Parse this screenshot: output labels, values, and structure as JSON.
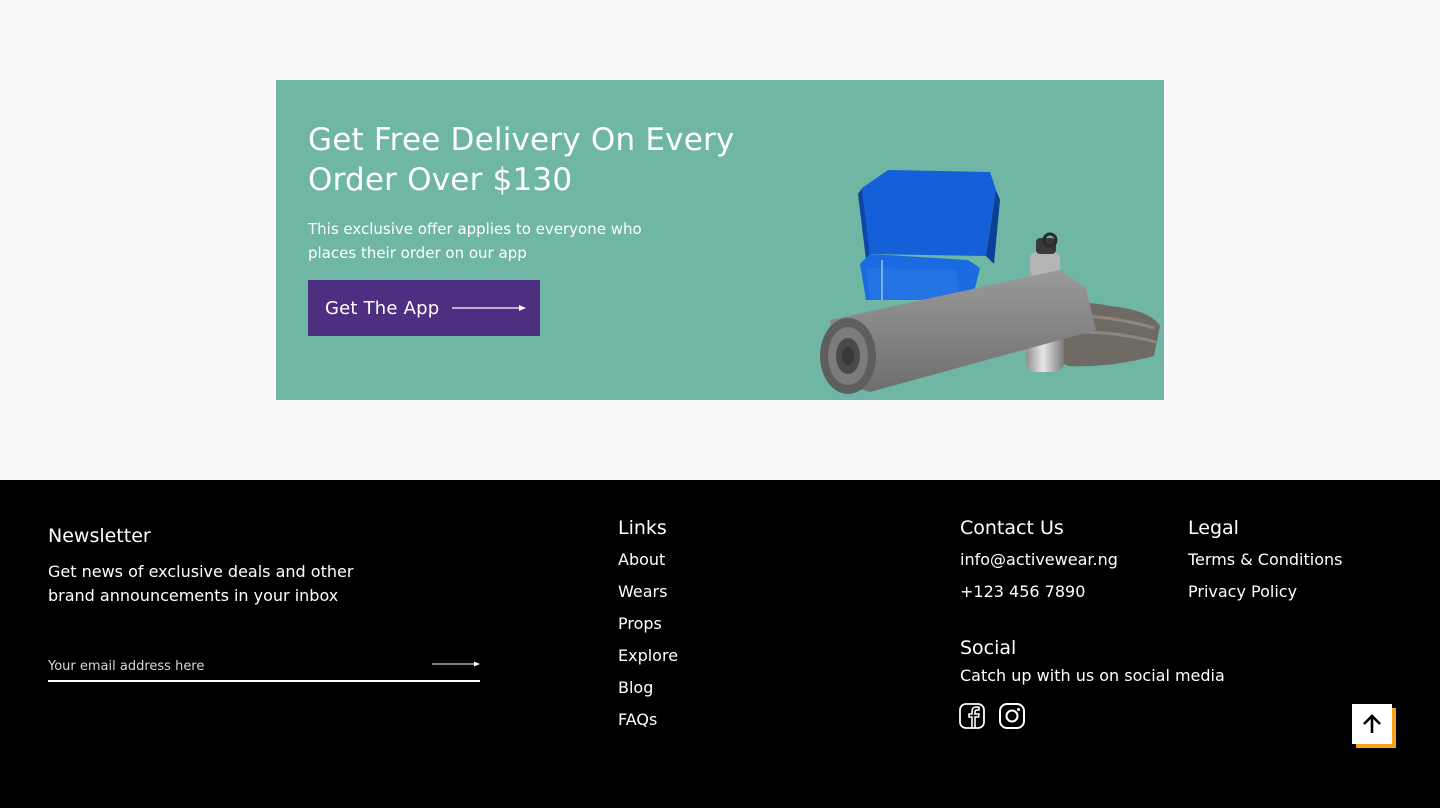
{
  "promo": {
    "title": "Get Free Delivery On Every Order Over $130",
    "subtitle": "This exclusive offer applies to everyone who places their order on our app",
    "cta_label": "Get The App",
    "background_color": "#6fb6a4",
    "cta_color": "#4d2e80",
    "image_icon": "fitness-gear-image"
  },
  "footer": {
    "newsletter": {
      "heading": "Newsletter",
      "description": "Get news of exclusive deals and other brand announcements  in your inbox",
      "email_placeholder": "Your email address here",
      "submit_icon": "arrow-right-icon"
    },
    "links": {
      "heading": "Links",
      "items": [
        "About",
        "Wears",
        "Props",
        "Explore",
        "Blog",
        "FAQs"
      ]
    },
    "contact": {
      "heading": "Contact Us",
      "email": "info@activewear.ng",
      "phone": "+123 456 7890"
    },
    "legal": {
      "heading": "Legal",
      "items": [
        "Terms & Conditions",
        "Privacy Policy"
      ]
    },
    "social": {
      "heading": "Social",
      "description": "Catch up with us on social media",
      "icons": [
        "facebook-icon",
        "instagram-icon"
      ]
    },
    "back_to_top": {
      "icon": "arrow-up-icon",
      "accent_color": "#f4a51c"
    }
  }
}
